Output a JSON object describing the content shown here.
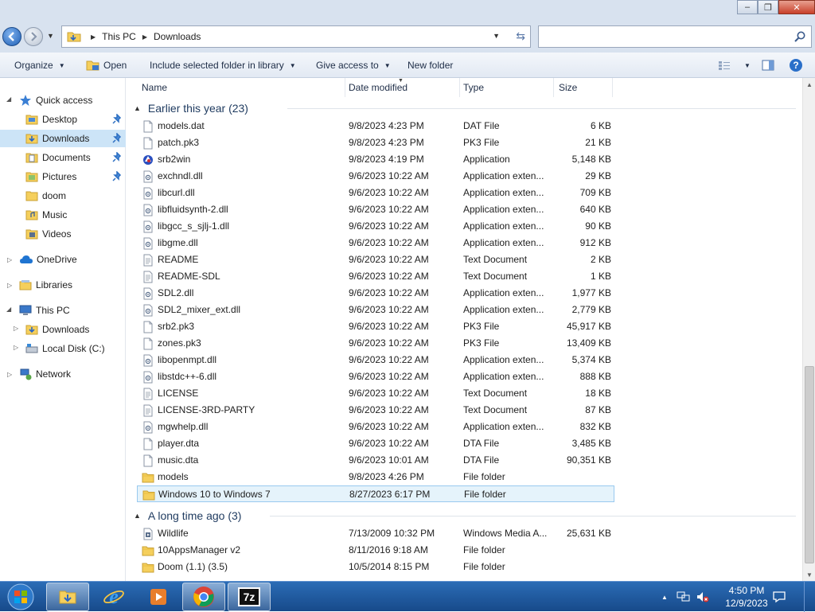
{
  "window": {
    "minimize_glyph": "–",
    "maximize_glyph": "❐",
    "close_glyph": "✕"
  },
  "address": {
    "crumbs": [
      "This PC",
      "Downloads"
    ],
    "search_placeholder": ""
  },
  "toolbar": {
    "organize": "Organize",
    "open": "Open",
    "include": "Include selected folder in library",
    "share": "Give access to",
    "new_folder": "New folder"
  },
  "nav": {
    "quick_access": "Quick access",
    "items": [
      {
        "label": "Desktop",
        "pinned": true
      },
      {
        "label": "Downloads",
        "pinned": true,
        "selected": true
      },
      {
        "label": "Documents",
        "pinned": true
      },
      {
        "label": "Pictures",
        "pinned": true
      },
      {
        "label": "doom",
        "pinned": false
      },
      {
        "label": "Music",
        "pinned": false
      },
      {
        "label": "Videos",
        "pinned": false
      }
    ],
    "onedrive": "OneDrive",
    "libraries": "Libraries",
    "this_pc": "This PC",
    "pc_items": [
      {
        "label": "Downloads"
      },
      {
        "label": "Local Disk (C:)"
      }
    ],
    "network": "Network"
  },
  "columns": {
    "name": "Name",
    "date": "Date modified",
    "type": "Type",
    "size": "Size"
  },
  "groups": [
    {
      "title": "Earlier this year (23)",
      "files": [
        {
          "name": "models.dat",
          "date": "9/8/2023 4:23 PM",
          "type": "DAT File",
          "size": "6 KB",
          "icon": "file-icon"
        },
        {
          "name": "patch.pk3",
          "date": "9/8/2023 4:23 PM",
          "type": "PK3 File",
          "size": "21 KB",
          "icon": "file-icon"
        },
        {
          "name": "srb2win",
          "date": "9/8/2023 4:19 PM",
          "type": "Application",
          "size": "5,148 KB",
          "icon": "app-icon"
        },
        {
          "name": "exchndl.dll",
          "date": "9/6/2023 10:22 AM",
          "type": "Application exten...",
          "size": "29 KB",
          "icon": "dll-icon"
        },
        {
          "name": "libcurl.dll",
          "date": "9/6/2023 10:22 AM",
          "type": "Application exten...",
          "size": "709 KB",
          "icon": "dll-icon"
        },
        {
          "name": "libfluidsynth-2.dll",
          "date": "9/6/2023 10:22 AM",
          "type": "Application exten...",
          "size": "640 KB",
          "icon": "dll-icon"
        },
        {
          "name": "libgcc_s_sjlj-1.dll",
          "date": "9/6/2023 10:22 AM",
          "type": "Application exten...",
          "size": "90 KB",
          "icon": "dll-icon"
        },
        {
          "name": "libgme.dll",
          "date": "9/6/2023 10:22 AM",
          "type": "Application exten...",
          "size": "912 KB",
          "icon": "dll-icon"
        },
        {
          "name": "README",
          "date": "9/6/2023 10:22 AM",
          "type": "Text Document",
          "size": "2 KB",
          "icon": "text-file-icon"
        },
        {
          "name": "README-SDL",
          "date": "9/6/2023 10:22 AM",
          "type": "Text Document",
          "size": "1 KB",
          "icon": "text-file-icon"
        },
        {
          "name": "SDL2.dll",
          "date": "9/6/2023 10:22 AM",
          "type": "Application exten...",
          "size": "1,977 KB",
          "icon": "dll-icon"
        },
        {
          "name": "SDL2_mixer_ext.dll",
          "date": "9/6/2023 10:22 AM",
          "type": "Application exten...",
          "size": "2,779 KB",
          "icon": "dll-icon"
        },
        {
          "name": "srb2.pk3",
          "date": "9/6/2023 10:22 AM",
          "type": "PK3 File",
          "size": "45,917 KB",
          "icon": "file-icon"
        },
        {
          "name": "zones.pk3",
          "date": "9/6/2023 10:22 AM",
          "type": "PK3 File",
          "size": "13,409 KB",
          "icon": "file-icon"
        },
        {
          "name": "libopenmpt.dll",
          "date": "9/6/2023 10:22 AM",
          "type": "Application exten...",
          "size": "5,374 KB",
          "icon": "dll-icon"
        },
        {
          "name": "libstdc++-6.dll",
          "date": "9/6/2023 10:22 AM",
          "type": "Application exten...",
          "size": "888 KB",
          "icon": "dll-icon"
        },
        {
          "name": "LICENSE",
          "date": "9/6/2023 10:22 AM",
          "type": "Text Document",
          "size": "18 KB",
          "icon": "text-file-icon"
        },
        {
          "name": "LICENSE-3RD-PARTY",
          "date": "9/6/2023 10:22 AM",
          "type": "Text Document",
          "size": "87 KB",
          "icon": "text-file-icon"
        },
        {
          "name": "mgwhelp.dll",
          "date": "9/6/2023 10:22 AM",
          "type": "Application exten...",
          "size": "832 KB",
          "icon": "dll-icon"
        },
        {
          "name": "player.dta",
          "date": "9/6/2023 10:22 AM",
          "type": "DTA File",
          "size": "3,485 KB",
          "icon": "file-icon"
        },
        {
          "name": "music.dta",
          "date": "9/6/2023 10:01 AM",
          "type": "DTA File",
          "size": "90,351 KB",
          "icon": "file-icon"
        },
        {
          "name": "models",
          "date": "9/8/2023 4:26 PM",
          "type": "File folder",
          "size": "",
          "icon": "folder-icon"
        },
        {
          "name": "Windows 10 to Windows 7",
          "date": "8/27/2023 6:17 PM",
          "type": "File folder",
          "size": "",
          "icon": "folder-icon",
          "hover": true
        }
      ]
    },
    {
      "title": "A long time ago (3)",
      "files": [
        {
          "name": "Wildlife",
          "date": "7/13/2009 10:32 PM",
          "type": "Windows Media A...",
          "size": "25,631 KB",
          "icon": "video-file-icon"
        },
        {
          "name": "10AppsManager v2",
          "date": "8/11/2016 9:18 AM",
          "type": "File folder",
          "size": "",
          "icon": "folder-icon"
        },
        {
          "name": "Doom (1.1) (3.5)",
          "date": "10/5/2014 8:15 PM",
          "type": "File folder",
          "size": "",
          "icon": "folder-icon"
        }
      ]
    }
  ],
  "taskbar": {
    "apps": [
      "file-explorer",
      "internet-explorer",
      "media-player",
      "chrome",
      "7zip"
    ],
    "sevenzip_label": "7z",
    "time": "4:50 PM",
    "date": "12/9/2023"
  },
  "colors": {
    "selection": "#cce4f7",
    "hover": "#e5f3fb",
    "group_title": "#1e3a5f",
    "folder": "#f5cf5c",
    "taskbar": "#1f5ba1"
  }
}
